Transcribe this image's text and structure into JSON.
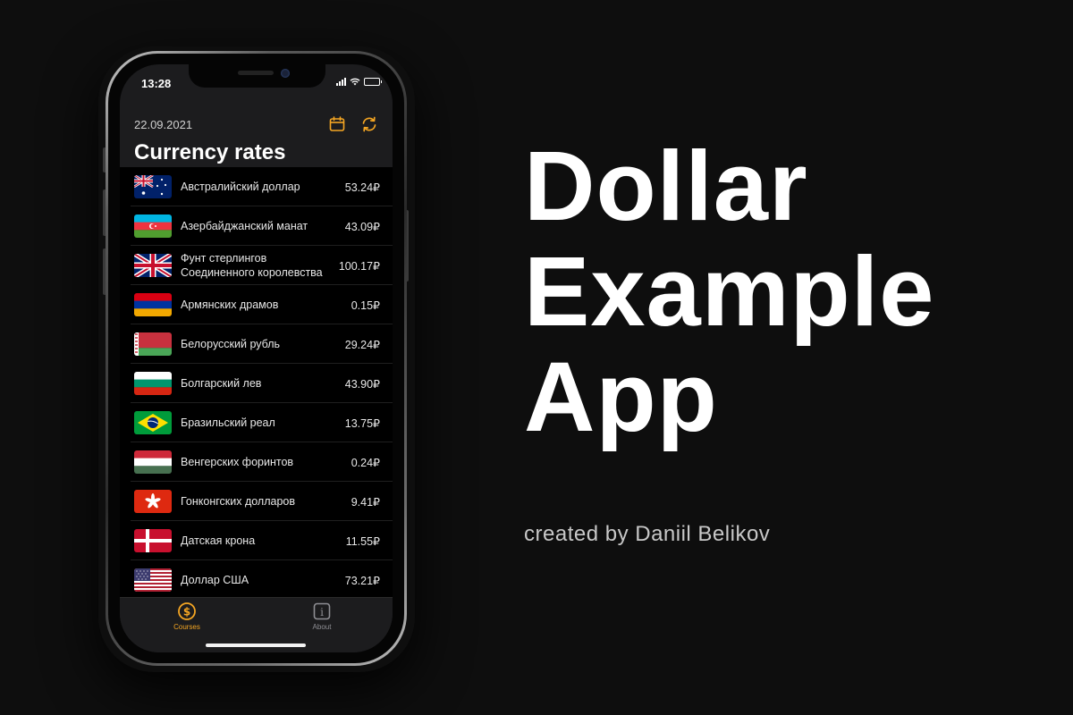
{
  "status_bar": {
    "time": "13:28"
  },
  "header": {
    "date": "22.09.2021",
    "title": "Currency rates",
    "calendar_icon": "calendar-icon",
    "refresh_icon": "refresh-icon"
  },
  "accent_color": "#f5a623",
  "currencies": [
    {
      "name": "Австралийский доллар",
      "rate": "53.24₽",
      "flag": "australia"
    },
    {
      "name": "Азербайджанский манат",
      "rate": "43.09₽",
      "flag": "azerbaijan"
    },
    {
      "name": "Фунт стерлингов Соединенного королевства",
      "rate": "100.17₽",
      "flag": "united-kingdom"
    },
    {
      "name": "Армянских драмов",
      "rate": "0.15₽",
      "flag": "armenia"
    },
    {
      "name": "Белорусский рубль",
      "rate": "29.24₽",
      "flag": "belarus"
    },
    {
      "name": "Болгарский лев",
      "rate": "43.90₽",
      "flag": "bulgaria"
    },
    {
      "name": "Бразильский реал",
      "rate": "13.75₽",
      "flag": "brazil"
    },
    {
      "name": "Венгерских форинтов",
      "rate": "0.24₽",
      "flag": "hungary"
    },
    {
      "name": "Гонконгских долларов",
      "rate": "9.41₽",
      "flag": "hong-kong"
    },
    {
      "name": "Датская крона",
      "rate": "11.55₽",
      "flag": "denmark"
    },
    {
      "name": "Доллар США",
      "rate": "73.21₽",
      "flag": "usa"
    }
  ],
  "tabs": [
    {
      "label": "Courses",
      "icon": "dollar-circle-icon",
      "active": true
    },
    {
      "label": "About",
      "icon": "info-icon",
      "active": false
    }
  ],
  "promo": {
    "title_lines": [
      "Dollar",
      "Example",
      "App"
    ],
    "credit": "created by Daniil Belikov"
  }
}
